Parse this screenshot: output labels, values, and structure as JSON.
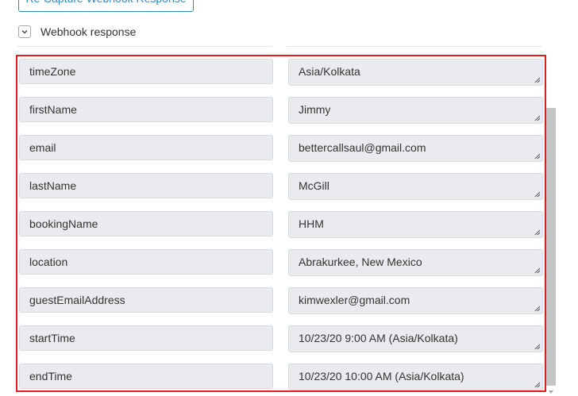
{
  "recapture_button": {
    "label": "Re-Capture Webhook Response"
  },
  "webhook_response": {
    "label": "Webhook response",
    "expanded": true,
    "toggle_icon": "chevron-down-icon"
  },
  "fields": [
    {
      "key": "timeZone",
      "value": "Asia/Kolkata"
    },
    {
      "key": "firstName",
      "value": "Jimmy"
    },
    {
      "key": "email",
      "value": "bettercallsaul@gmail.com"
    },
    {
      "key": "lastName",
      "value": "McGill"
    },
    {
      "key": "bookingName",
      "value": "HHM"
    },
    {
      "key": "location",
      "value": "Abrakurkee, New Mexico"
    },
    {
      "key": "guestEmailAddress",
      "value": "kimwexler@gmail.com"
    },
    {
      "key": "startTime",
      "value": "10/23/20 9:00 AM (Asia/Kolkata)"
    },
    {
      "key": "endTime",
      "value": "10/23/20 10:00 AM (Asia/Kolkata)"
    }
  ],
  "colors": {
    "highlight_border": "#e0201e",
    "accent": "#2f86c5",
    "field_background": "#e9ebee"
  }
}
